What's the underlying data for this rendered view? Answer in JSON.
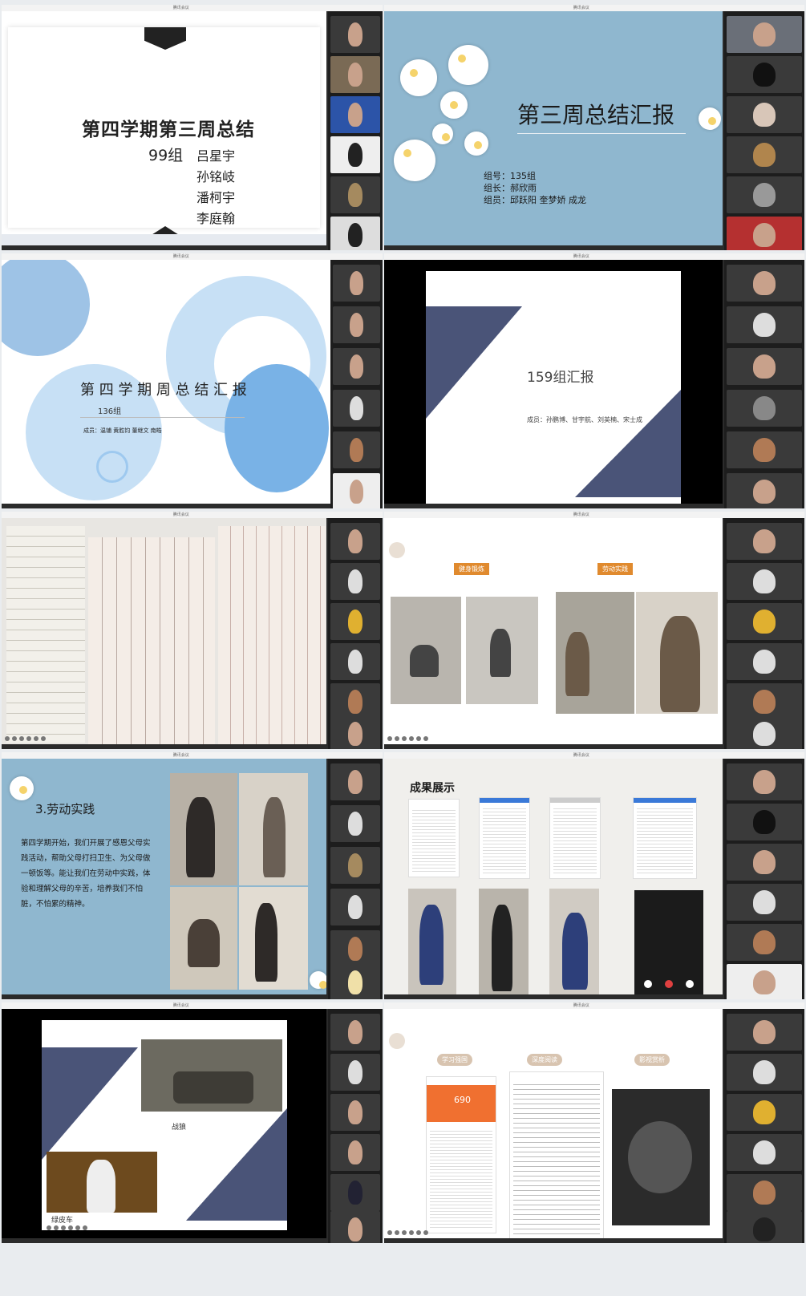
{
  "window_title": "腾讯会议",
  "tiles": {
    "t1": {
      "title": "第四学期第三周总结",
      "group": "99组",
      "members": [
        "吕星宇",
        "孙铭岐",
        "潘柯宇",
        "李庭翰"
      ]
    },
    "t2": {
      "title": "第三周总结汇报",
      "group_no": "组号：135组",
      "leader": "组长：郝欣雨",
      "members": "组员：邱跃阳  奎梦娇  成龙"
    },
    "t3": {
      "title": "第 四 学 期 周 总 结 汇 报",
      "group": "136组",
      "members": "成员：温铺  黄胜钧  董继文  南皓"
    },
    "t4": {
      "title": "159组汇报",
      "members": "成员：孙鹏博、甘宇航、刘英楠、宋士成"
    },
    "t6": {
      "tag_left": "健身锻炼",
      "tag_right": "劳动实践"
    },
    "t7": {
      "heading": "3.劳动实践",
      "body": "第四学期开始，我们开展了感恩父母实践活动，帮助父母打扫卫生、为父母做一顿饭等。能让我们在劳动中实践，体验和理解父母的辛苦，培养我们不怕脏，不怕累的精神。"
    },
    "t8": {
      "heading": "成果展示"
    },
    "t9": {
      "caption_top": "战狼",
      "caption_bottom": "绿皮车"
    },
    "t10": {
      "tabs": [
        "学习强国",
        "深度阅读",
        "影视赏析"
      ],
      "score": "690"
    }
  }
}
